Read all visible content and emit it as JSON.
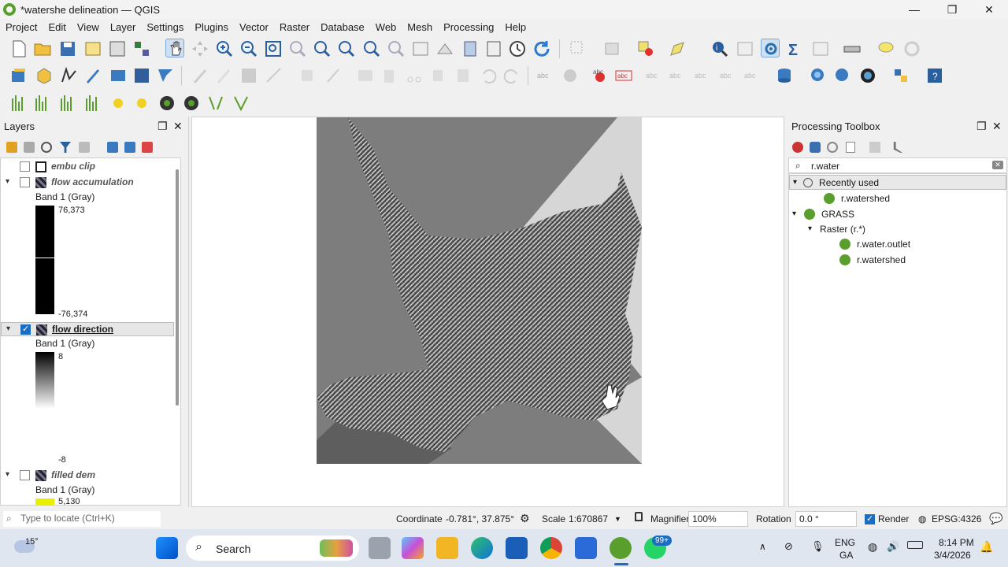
{
  "window": {
    "title": "*watershe delineation — QGIS",
    "minimize": "—",
    "maximize": "❐",
    "close": "✕"
  },
  "menu": [
    "Project",
    "Edit",
    "View",
    "Layer",
    "Settings",
    "Plugins",
    "Vector",
    "Raster",
    "Database",
    "Web",
    "Mesh",
    "Processing",
    "Help"
  ],
  "layers_panel": {
    "title": "Layers",
    "layers": [
      {
        "name": "embu clip",
        "checked": false
      },
      {
        "name": "flow accumulation",
        "checked": false,
        "band": "Band 1 (Gray)",
        "max": "76,373",
        "min": "-76,374"
      },
      {
        "name": "flow direction",
        "checked": true,
        "band": "Band 1 (Gray)",
        "max": "8",
        "min": "-8"
      },
      {
        "name": "filled dem",
        "checked": false,
        "band": "Band 1 (Gray)",
        "max": "5,130"
      }
    ]
  },
  "toolbox": {
    "title": "Processing Toolbox",
    "search_value": "r.water",
    "recently_used": "Recently used",
    "recent_items": [
      "r.watershed"
    ],
    "grass": "GRASS",
    "raster_group": "Raster (r.*)",
    "raster_items": [
      "r.water.outlet",
      "r.watershed"
    ]
  },
  "statusbar": {
    "locate_placeholder": "Type to locate (Ctrl+K)",
    "coordinate_label": "Coordinate",
    "coordinate_value": "-0.781°, 37.875°",
    "scale_label": "Scale",
    "scale_value": "1:670867",
    "magnifier_label": "Magnifier",
    "magnifier_value": "100%",
    "rotation_label": "Rotation",
    "rotation_value": "0.0 °",
    "render_label": "Render",
    "crs": "EPSG:4326"
  },
  "taskbar": {
    "weather": "15°",
    "search_label": "Search",
    "whatsapp_badge": "99+",
    "lang_line1": "ENG",
    "lang_line2": "GA",
    "time": "8:14 PM",
    "date": "3/4/2026"
  },
  "colors": {
    "accent": "#1b6dc1",
    "qgis_green": "#5a9e2e",
    "ramp_yellow": "#e8f000"
  }
}
